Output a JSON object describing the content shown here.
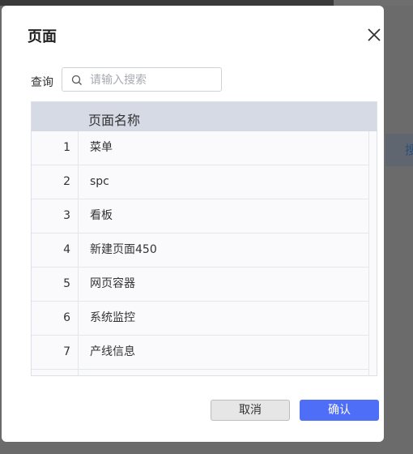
{
  "dialog": {
    "title": "页面",
    "query_label": "查询",
    "search_placeholder": "请输入搜索",
    "search_value": "",
    "cancel_label": "取消",
    "confirm_label": "确认"
  },
  "table": {
    "header": "页面名称",
    "rows": [
      {
        "index": "1",
        "name": "菜单"
      },
      {
        "index": "2",
        "name": "spc"
      },
      {
        "index": "3",
        "name": "看板"
      },
      {
        "index": "4",
        "name": "新建页面450"
      },
      {
        "index": "5",
        "name": "网页容器"
      },
      {
        "index": "6",
        "name": "系统监控"
      },
      {
        "index": "7",
        "name": "产线信息"
      },
      {
        "index": "",
        "name": ""
      }
    ]
  },
  "background": {
    "fragment_text": "搜"
  },
  "colors": {
    "primary": "#4f6ef7",
    "header_bg": "#d5dae4",
    "overlay": "#6b6b6b"
  }
}
